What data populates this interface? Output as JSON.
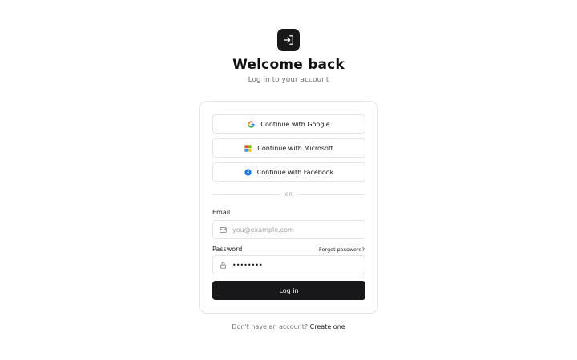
{
  "header": {
    "logo_icon": "log-in-icon",
    "title": "Welcome back",
    "subtitle": "Log in to your account"
  },
  "social": {
    "google_label": "Continue with Google",
    "microsoft_label": "Continue with Microsoft",
    "facebook_label": "Continue with Facebook"
  },
  "divider": {
    "text": "OR"
  },
  "form": {
    "email_label": "Email",
    "email_placeholder": "you@example.com",
    "email_value": "",
    "password_label": "Password",
    "password_value": "password",
    "forgot_label": "Forgot password?",
    "submit_label": "Log in"
  },
  "footer": {
    "prompt": "Don't have an account?",
    "link": "Create one"
  },
  "colors": {
    "primary": "#18181b",
    "border": "#e4e4e7",
    "muted": "#71717a",
    "google_red": "#ea4335",
    "google_blue": "#4285f4",
    "google_yellow": "#fbbc05",
    "google_green": "#34a853",
    "microsoft_red": "#f25022",
    "microsoft_green": "#7fba00",
    "microsoft_blue": "#00a4ef",
    "microsoft_yellow": "#ffb900",
    "facebook_blue": "#1877f2"
  }
}
